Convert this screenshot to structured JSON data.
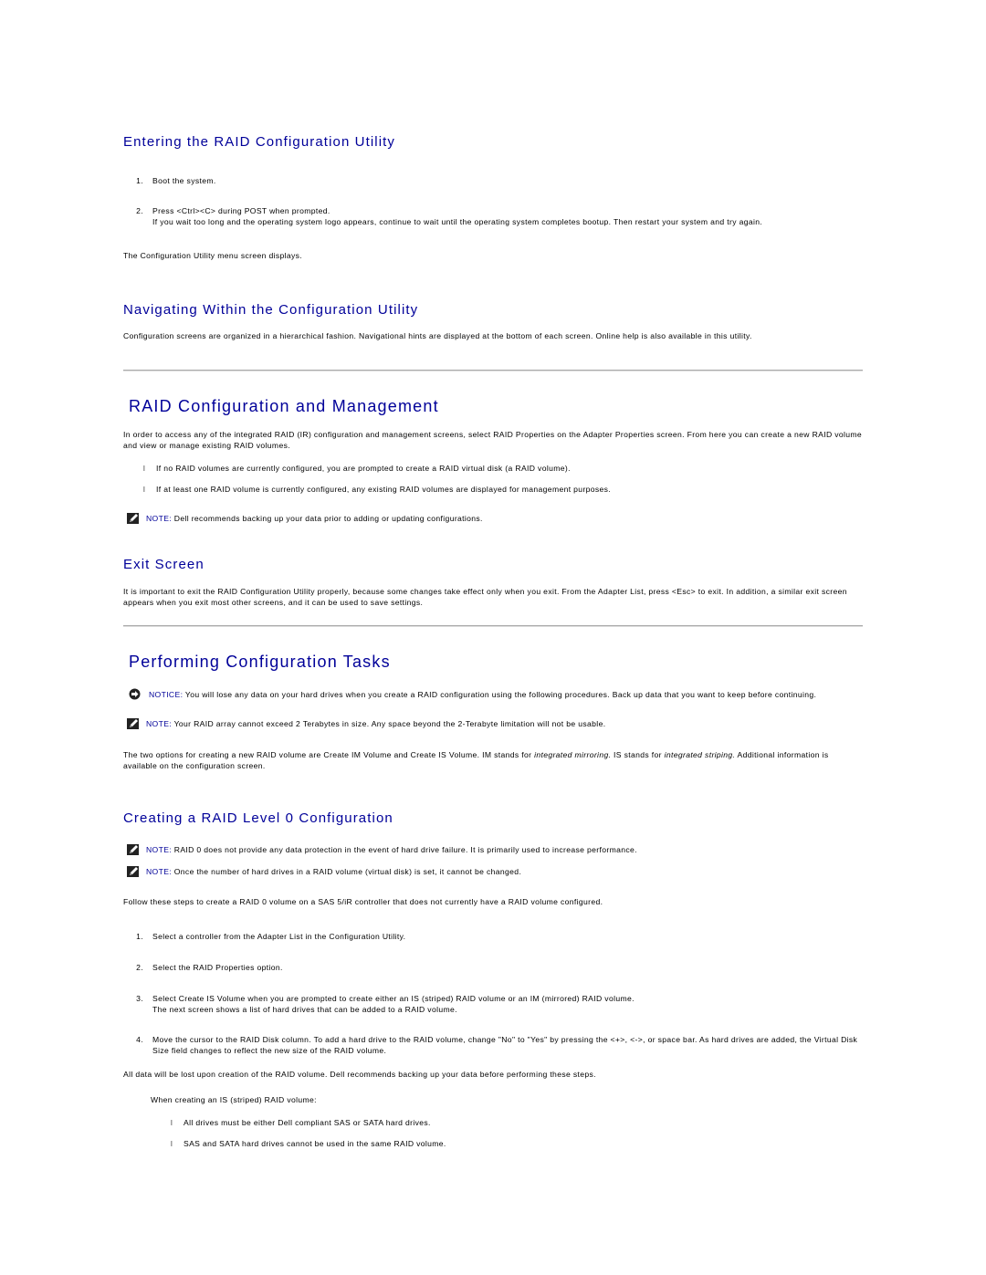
{
  "sections": {
    "entering": {
      "title": "Entering the RAID Configuration Utility",
      "steps": [
        {
          "num": "1.",
          "text": "Boot the system."
        },
        {
          "num": "2.",
          "text": "Press <Ctrl><C> during POST when prompted.",
          "detail": "If you wait too long and the operating system logo appears, continue to wait until the operating system completes bootup. Then restart your system and try again."
        }
      ],
      "after": "The Configuration Utility menu screen displays."
    },
    "navigating": {
      "title": "Navigating Within the Configuration Utility",
      "body": "Configuration screens are organized in a hierarchical fashion. Navigational hints are displayed at the bottom of each screen. Online help is also available in this utility."
    },
    "raid_config": {
      "title": "RAID Configuration and Management",
      "body": "In order to access any of the integrated RAID (IR) configuration and management screens, select RAID Properties on the Adapter Properties screen. From here you can create a new RAID volume and view or manage existing RAID volumes.",
      "bullets": [
        "If no RAID volumes are currently configured, you are prompted to create a RAID virtual disk (a RAID volume).",
        "If at least one RAID volume is currently configured, any existing RAID volumes are displayed for management purposes."
      ],
      "note_label": "NOTE:",
      "note": "Dell recommends backing up your data prior to adding or updating configurations."
    },
    "exit": {
      "title": "Exit Screen",
      "body": "It is important to exit the RAID Configuration Utility properly, because some changes take effect only when you exit. From the Adapter List, press <Esc> to exit. In addition, a similar exit screen appears when you exit most other screens, and it can be used to save settings."
    },
    "performing": {
      "title": "Performing Configuration Tasks",
      "notice_label": "NOTICE:",
      "notice": "You will lose any data on your hard drives when you create a RAID configuration using the following procedures. Back up data that you want to keep before continuing.",
      "note_label": "NOTE:",
      "note": "Your RAID array cannot exceed 2 Terabytes in size. Any space beyond the 2-Terabyte limitation will not be usable.",
      "body_part1": "The two options for creating a new RAID volume are Create IM Volume and Create IS Volume. IM stands for ",
      "body_em1": "integrated mirroring.",
      "body_part2": " IS stands for ",
      "body_em2": "integrated striping.",
      "body_part3": " Additional information is available on the configuration screen."
    },
    "raid0": {
      "title": "Creating a RAID Level 0 Configuration",
      "notes": [
        {
          "label": "NOTE:",
          "text": "RAID 0 does not provide any data protection in the event of hard drive failure. It is primarily used to increase performance."
        },
        {
          "label": "NOTE:",
          "text": "Once the number of hard drives in a RAID volume (virtual disk) is set, it cannot be changed."
        }
      ],
      "intro": "Follow these steps to create a RAID 0 volume on a SAS 5/iR controller that does not currently have a RAID volume configured.",
      "steps": [
        {
          "num": "1.",
          "text": "Select a controller from the Adapter List in the Configuration Utility."
        },
        {
          "num": "2.",
          "text": "Select the RAID Properties option."
        },
        {
          "num": "3.",
          "text": "Select Create IS Volume when you are prompted to create either an IS (striped) RAID volume or an IM (mirrored) RAID volume.",
          "detail": "The next screen shows a list of hard drives that can be added to a RAID volume."
        },
        {
          "num": "4.",
          "text": "Move the cursor to the RAID Disk column. To add a hard drive to the RAID volume, change \"No\" to \"Yes\" by pressing the <+>, <->, or space bar. As hard drives are added, the Virtual Disk Size field changes to reflect the new size of the RAID volume."
        }
      ],
      "warning": "All data will be lost upon creation of the RAID volume. Dell recommends backing up your data before performing these steps.",
      "sub_intro": "When creating an IS (striped) RAID volume:",
      "sub_bullets": [
        "All drives must be either Dell compliant SAS or SATA hard drives.",
        "SAS and SATA hard drives cannot be used in the same RAID volume."
      ]
    }
  },
  "bullet_glyph": "l",
  "colors": {
    "heading": "#000099",
    "note_label": "#000099",
    "text": "#000000",
    "rule": "#aaaaaa"
  }
}
